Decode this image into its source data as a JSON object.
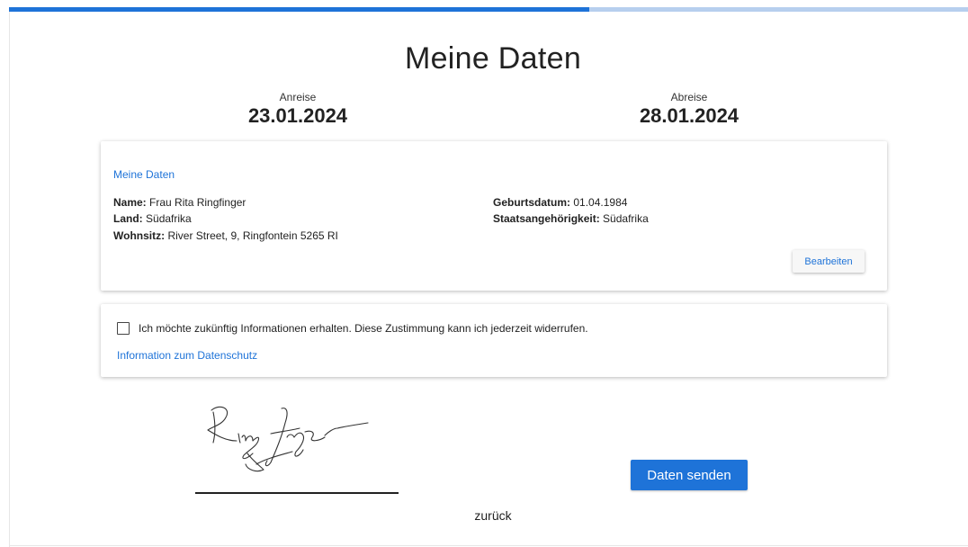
{
  "progress": {
    "fraction": 0.605,
    "fill_color": "#1e73d8",
    "track_color": "#b7cfee"
  },
  "page": {
    "title": "Meine Daten"
  },
  "stay": {
    "arrival_label": "Anreise",
    "arrival_date": "23.01.2024",
    "departure_label": "Abreise",
    "departure_date": "28.01.2024"
  },
  "personal_card": {
    "heading": "Meine Daten",
    "name_label": "Name:",
    "name_value": "Frau Rita Ringfinger",
    "country_label": "Land:",
    "country_value": "Südafrika",
    "residence_label": "Wohnsitz:",
    "residence_value": "River Street, 9, Ringfontein 5265 RI",
    "birthdate_label": "Geburtsdatum:",
    "birthdate_value": "01.04.1984",
    "nationality_label": "Staatsangehörigkeit:",
    "nationality_value": "Südafrika",
    "edit_button": "Bearbeiten"
  },
  "consent_card": {
    "checked": false,
    "consent_text": "Ich möchte zukünftig Informationen erhalten. Diese Zustimmung kann ich jederzeit widerrufen.",
    "privacy_link": "Information zum Datenschutz"
  },
  "signature": {
    "name": "Ringfinger"
  },
  "actions": {
    "submit_button": "Daten senden",
    "back_link": "zurück"
  },
  "colors": {
    "accent": "#1e73d8",
    "text": "#222222"
  }
}
